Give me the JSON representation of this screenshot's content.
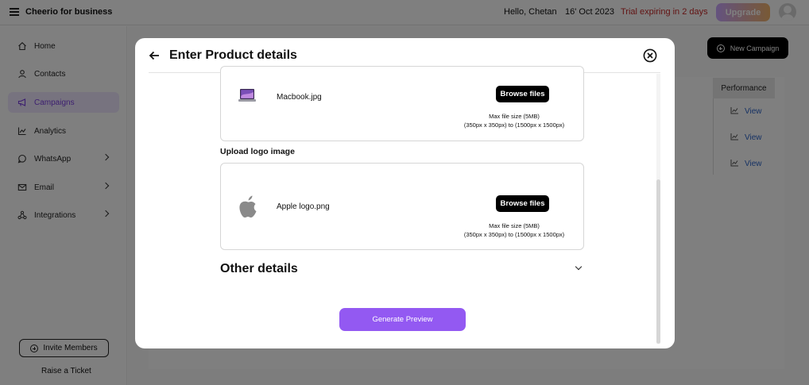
{
  "topbar": {
    "brand": "Cheerio for business",
    "greeting": "Hello, Chetan",
    "date": "16' Oct 2023",
    "trial": "Trial expiring in 2 days",
    "upgrade_label": "Upgrade"
  },
  "sidebar": {
    "items": [
      {
        "label": "Home",
        "icon": "home-icon"
      },
      {
        "label": "Contacts",
        "icon": "user-icon"
      },
      {
        "label": "Campaigns",
        "icon": "megaphone-icon",
        "active": true
      },
      {
        "label": "Analytics",
        "icon": "chart-line-icon"
      },
      {
        "label": "WhatsApp",
        "icon": "whatsapp-icon",
        "expandable": true
      },
      {
        "label": "Email",
        "icon": "mail-icon",
        "expandable": true
      },
      {
        "label": "Integrations",
        "icon": "integrations-icon",
        "expandable": true
      }
    ],
    "invite_label": "Invite Members",
    "ticket_label": "Raise a Ticket"
  },
  "main": {
    "new_campaign_label": "New Campaign",
    "performance_header": "Performance",
    "view_links": [
      "View",
      "View",
      "View"
    ]
  },
  "modal": {
    "title": "Enter Product details",
    "product_file": {
      "name": "Macbook.jpg",
      "browse_label": "Browse files",
      "note_line1": "Max file size (5MB)",
      "note_line2": "(350px x 350px) to (1500px x 1500px)"
    },
    "logo_section_label": "Upload logo image",
    "logo_file": {
      "name": "Apple logo.png",
      "browse_label": "Browse files",
      "note_line1": "Max file size (5MB)",
      "note_line2": "(350px x 350px) to (1500px x 1500px)"
    },
    "other_details_label": "Other details",
    "generate_label": "Generate Preview"
  },
  "colors": {
    "accent": "#9359f2",
    "trial_text": "#c62828",
    "link": "#2c64c8"
  }
}
